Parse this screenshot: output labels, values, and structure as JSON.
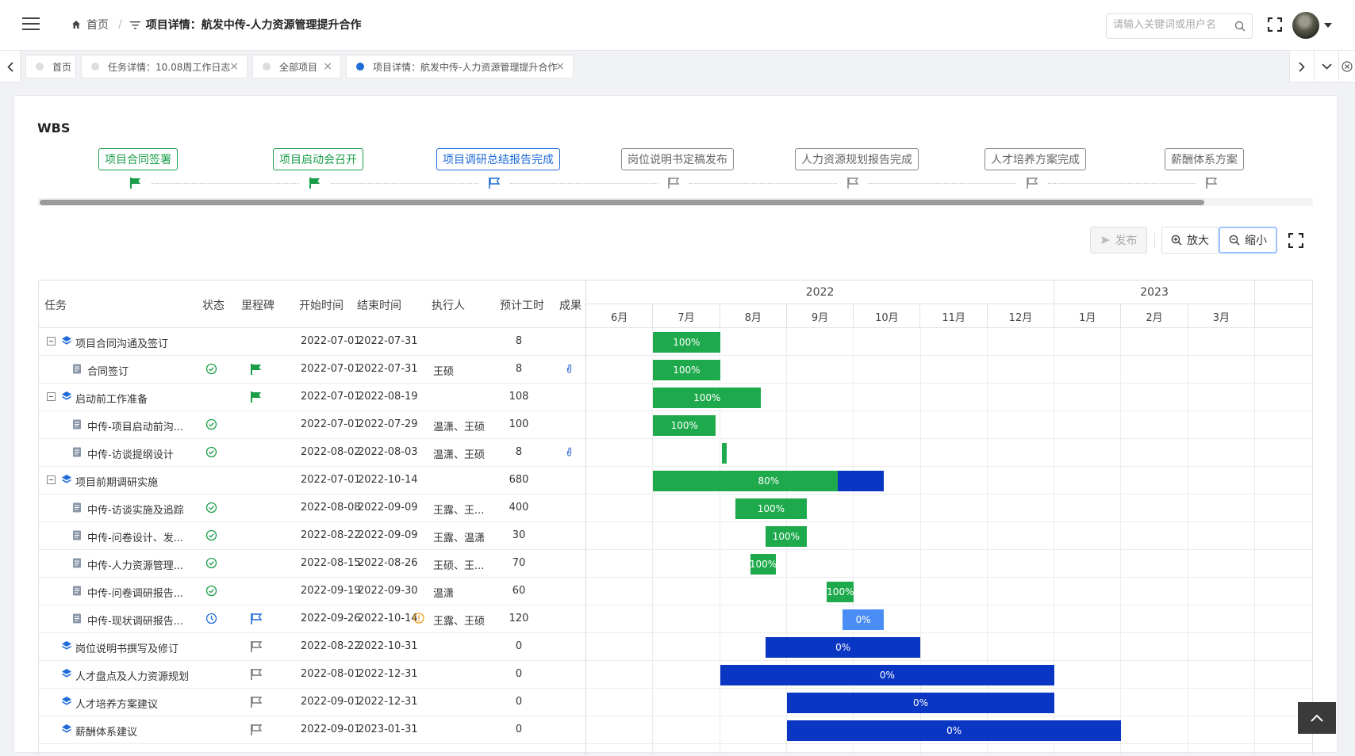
{
  "header": {
    "home_label": "首页",
    "current_page": "项目详情：航发中传-人力资源管理提升合作",
    "search_placeholder": "请输入关键词或用户名"
  },
  "tabs": [
    {
      "label": "首页",
      "closable": false,
      "active": false
    },
    {
      "label": "任务详情：10.08周工作日志",
      "closable": true,
      "active": false
    },
    {
      "label": "全部项目",
      "closable": true,
      "active": false
    },
    {
      "label": "项目详情：航发中传-人力资源管理提升合作",
      "closable": true,
      "active": true
    }
  ],
  "wbs": {
    "title": "WBS",
    "milestones": [
      {
        "label": "项目合同签署",
        "state": "done"
      },
      {
        "label": "项目启动会召开",
        "state": "done"
      },
      {
        "label": "项目调研总结报告完成",
        "state": "current"
      },
      {
        "label": "岗位说明书定稿发布",
        "state": "todo"
      },
      {
        "label": "人力资源规划报告完成",
        "state": "todo"
      },
      {
        "label": "人才培养方案完成",
        "state": "todo"
      },
      {
        "label": "薪酬体系方案",
        "state": "todo"
      }
    ]
  },
  "toolbar": {
    "publish_label": "发布",
    "zoom_in_label": "放大",
    "zoom_out_label": "缩小"
  },
  "table": {
    "columns": [
      "任务",
      "状态",
      "里程碑",
      "开始时间",
      "结束时间",
      "执行人",
      "预计工时",
      "成果"
    ],
    "rows": [
      {
        "name": "项目合同沟通及签订",
        "level": 0,
        "collapsible": true,
        "status": "",
        "milestone": "",
        "start": "2022-07-01",
        "end": "2022-07-31",
        "owner": "",
        "hours": "8",
        "attachment": false,
        "warn": false
      },
      {
        "name": "合同签订",
        "level": 1,
        "collapsible": false,
        "status": "done",
        "milestone": "done",
        "start": "2022-07-01",
        "end": "2022-07-31",
        "owner": "王硕",
        "hours": "8",
        "attachment": true,
        "warn": false
      },
      {
        "name": "启动前工作准备",
        "level": 0,
        "collapsible": true,
        "status": "",
        "milestone": "done",
        "start": "2022-07-01",
        "end": "2022-08-19",
        "owner": "",
        "hours": "108",
        "attachment": false,
        "warn": false
      },
      {
        "name": "中传-项目启动前沟...",
        "level": 1,
        "collapsible": false,
        "status": "done",
        "milestone": "",
        "start": "2022-07-01",
        "end": "2022-07-29",
        "owner": "温潇、王硕",
        "hours": "100",
        "attachment": false,
        "warn": false
      },
      {
        "name": "中传-访谈提纲设计",
        "level": 1,
        "collapsible": false,
        "status": "done",
        "milestone": "",
        "start": "2022-08-02",
        "end": "2022-08-03",
        "owner": "温潇、王硕",
        "hours": "8",
        "attachment": true,
        "warn": false
      },
      {
        "name": "项目前期调研实施",
        "level": 0,
        "collapsible": true,
        "status": "",
        "milestone": "",
        "start": "2022-07-01",
        "end": "2022-10-14",
        "owner": "",
        "hours": "680",
        "attachment": false,
        "warn": false
      },
      {
        "name": "中传-访谈实施及追踪",
        "level": 1,
        "collapsible": false,
        "status": "done",
        "milestone": "",
        "start": "2022-08-08",
        "end": "2022-09-09",
        "owner": "王露、王...",
        "hours": "400",
        "attachment": false,
        "warn": false
      },
      {
        "name": "中传-问卷设计、发...",
        "level": 1,
        "collapsible": false,
        "status": "done",
        "milestone": "",
        "start": "2022-08-22",
        "end": "2022-09-09",
        "owner": "王露、温潇",
        "hours": "30",
        "attachment": false,
        "warn": false
      },
      {
        "name": "中传-人力资源管理...",
        "level": 1,
        "collapsible": false,
        "status": "done",
        "milestone": "",
        "start": "2022-08-15",
        "end": "2022-08-26",
        "owner": "王硕、王...",
        "hours": "70",
        "attachment": false,
        "warn": false
      },
      {
        "name": "中传-问卷调研报告...",
        "level": 1,
        "collapsible": false,
        "status": "done",
        "milestone": "",
        "start": "2022-09-19",
        "end": "2022-09-30",
        "owner": "温潇",
        "hours": "60",
        "attachment": false,
        "warn": false
      },
      {
        "name": "中传-现状调研报告...",
        "level": 1,
        "collapsible": false,
        "status": "pending",
        "milestone": "current",
        "start": "2022-09-26",
        "end": "2022-10-14",
        "owner": "王露、王硕",
        "hours": "120",
        "attachment": false,
        "warn": true
      },
      {
        "name": "岗位说明书撰写及修订",
        "level": 0,
        "collapsible": false,
        "status": "",
        "milestone": "todo",
        "start": "2022-08-22",
        "end": "2022-10-31",
        "owner": "",
        "hours": "0",
        "attachment": false,
        "warn": false
      },
      {
        "name": "人才盘点及人力资源规划",
        "level": 0,
        "collapsible": false,
        "status": "",
        "milestone": "todo",
        "start": "2022-08-01",
        "end": "2022-12-31",
        "owner": "",
        "hours": "0",
        "attachment": false,
        "warn": false
      },
      {
        "name": "人才培养方案建议",
        "level": 0,
        "collapsible": false,
        "status": "",
        "milestone": "todo",
        "start": "2022-09-01",
        "end": "2022-12-31",
        "owner": "",
        "hours": "0",
        "attachment": false,
        "warn": false
      },
      {
        "name": "薪酬体系建议",
        "level": 0,
        "collapsible": false,
        "status": "",
        "milestone": "todo",
        "start": "2022-09-01",
        "end": "2023-01-31",
        "owner": "",
        "hours": "0",
        "attachment": false,
        "warn": false
      }
    ]
  },
  "gantt": {
    "years": [
      {
        "label": "2022",
        "months": 7
      },
      {
        "label": "2023",
        "months": 3
      }
    ],
    "months": [
      "6月",
      "7月",
      "8月",
      "9月",
      "10月",
      "11月",
      "12月",
      "1月",
      "2月",
      "3月"
    ],
    "first_month": "2022-06",
    "bars": [
      {
        "start": "2022-07-01",
        "end": "2022-07-31",
        "progress": 100,
        "label": "100%",
        "color": "#1eaa4c"
      },
      {
        "start": "2022-07-01",
        "end": "2022-07-31",
        "progress": 100,
        "label": "100%",
        "color": "#1eaa4c"
      },
      {
        "start": "2022-07-01",
        "end": "2022-08-19",
        "progress": 100,
        "label": "100%",
        "color": "#1eaa4c"
      },
      {
        "start": "2022-07-01",
        "end": "2022-07-29",
        "progress": 100,
        "label": "100%",
        "color": "#1eaa4c"
      },
      {
        "start": "2022-08-02",
        "end": "2022-08-03",
        "progress": 100,
        "label": "",
        "color": "#1eaa4c"
      },
      {
        "start": "2022-07-01",
        "end": "2022-10-14",
        "progress": 80,
        "label": "80%",
        "color": "#0a36c4"
      },
      {
        "start": "2022-08-08",
        "end": "2022-09-09",
        "progress": 100,
        "label": "100%",
        "color": "#1eaa4c"
      },
      {
        "start": "2022-08-22",
        "end": "2022-09-09",
        "progress": 100,
        "label": "100%",
        "color": "#1eaa4c"
      },
      {
        "start": "2022-08-15",
        "end": "2022-08-26",
        "progress": 100,
        "label": "100%",
        "color": "#1eaa4c"
      },
      {
        "start": "2022-09-19",
        "end": "2022-09-30",
        "progress": 100,
        "label": "100%",
        "color": "#1eaa4c"
      },
      {
        "start": "2022-09-26",
        "end": "2022-10-14",
        "progress": 0,
        "label": "0%",
        "color": "#4a8ef5"
      },
      {
        "start": "2022-08-22",
        "end": "2022-10-31",
        "progress": 0,
        "label": "0%",
        "color": "#0a36c4"
      },
      {
        "start": "2022-08-01",
        "end": "2022-12-31",
        "progress": 0,
        "label": "0%",
        "color": "#0a36c4"
      },
      {
        "start": "2022-09-01",
        "end": "2022-12-31",
        "progress": 0,
        "label": "0%",
        "color": "#0a36c4"
      },
      {
        "start": "2022-09-01",
        "end": "2023-01-31",
        "progress": 0,
        "label": "0%",
        "color": "#0a36c4"
      }
    ]
  },
  "colors": {
    "done_green": "#1a9e4a",
    "current_blue": "#1f6bd8",
    "layer_icon_blue": "#1f6bd8",
    "warn_orange": "#f0a020"
  }
}
